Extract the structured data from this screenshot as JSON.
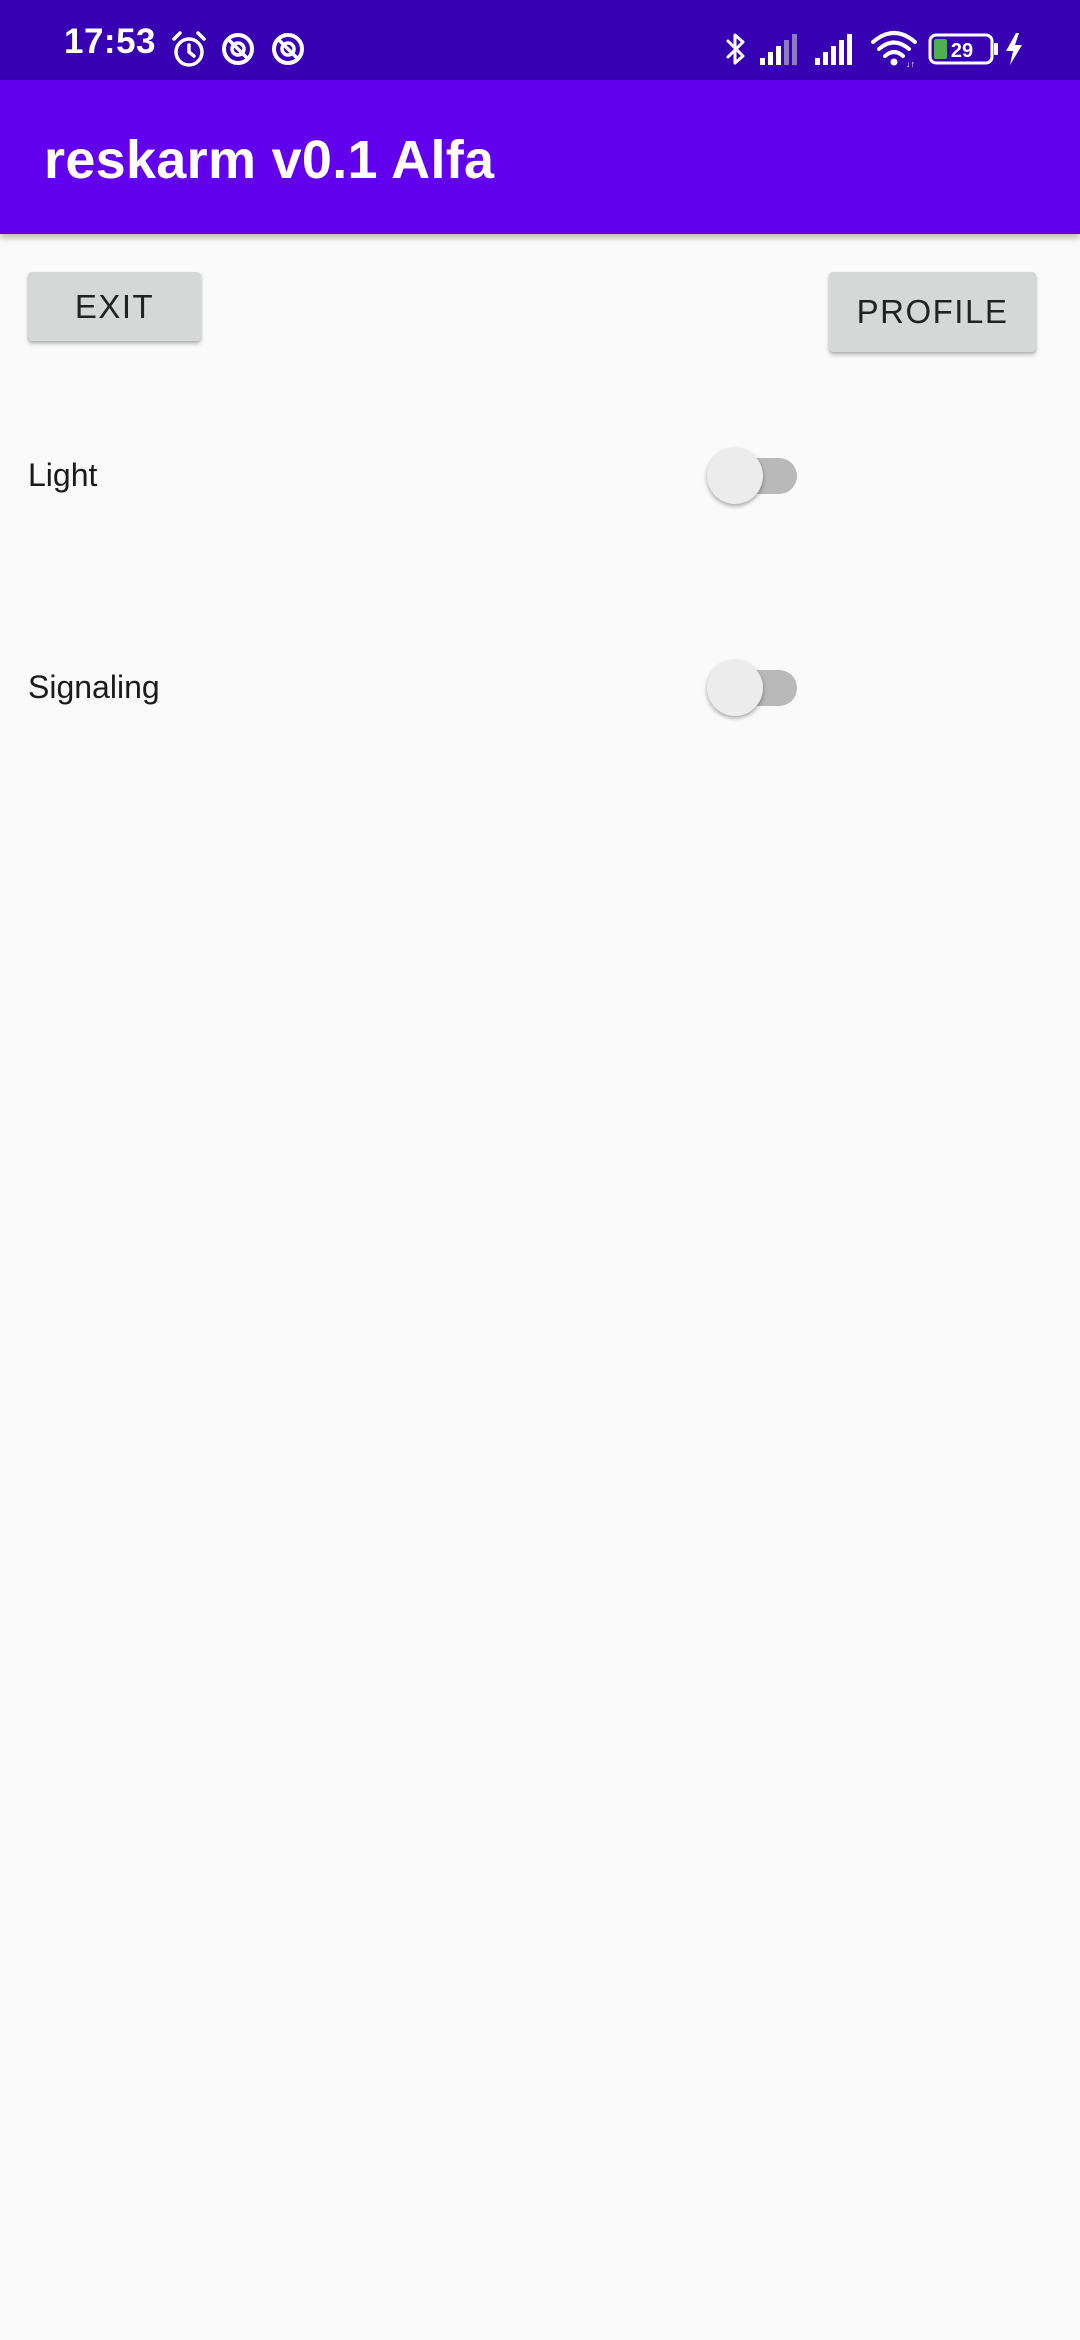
{
  "status_bar": {
    "time": "17:53",
    "battery_level": "29",
    "icons": [
      "alarm-icon",
      "do-not-disturb-icon",
      "do-not-disturb-icon",
      "bluetooth-icon",
      "signal-icon",
      "signal-icon",
      "wifi-icon",
      "battery-icon",
      "charging-icon"
    ],
    "background": "#3700b3"
  },
  "app_bar": {
    "title": "reskarm v0.1 Alfa",
    "background": "#6200ee"
  },
  "buttons": {
    "exit_label": "EXIT",
    "profile_label": "PROFILE"
  },
  "settings": [
    {
      "label": "Light",
      "enabled": false
    },
    {
      "label": "Signaling",
      "enabled": false
    }
  ]
}
